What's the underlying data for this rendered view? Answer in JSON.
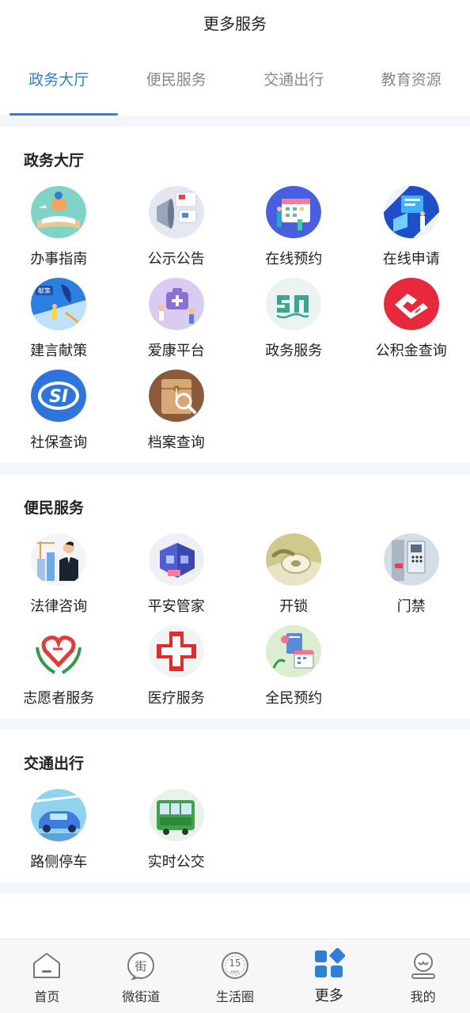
{
  "header": {
    "title": "更多服务"
  },
  "tabs": [
    {
      "label": "政务大厅"
    },
    {
      "label": "便民服务"
    },
    {
      "label": "交通出行"
    },
    {
      "label": "教育资源"
    }
  ],
  "sections": {
    "gov": {
      "title": "政务大厅",
      "items": [
        {
          "label": "办事指南",
          "icon": "guide-icon"
        },
        {
          "label": "公示公告",
          "icon": "announcement-icon"
        },
        {
          "label": "在线预约",
          "icon": "online-booking-icon"
        },
        {
          "label": "在线申请",
          "icon": "online-application-icon"
        },
        {
          "label": "建言献策",
          "icon": "suggestion-icon"
        },
        {
          "label": "爱康平台",
          "icon": "health-platform-icon"
        },
        {
          "label": "政务服务",
          "icon": "government-service-icon"
        },
        {
          "label": "公积金查询",
          "icon": "housing-fund-icon"
        },
        {
          "label": "社保查询",
          "icon": "social-security-icon"
        },
        {
          "label": "档案查询",
          "icon": "archive-icon"
        }
      ]
    },
    "life": {
      "title": "便民服务",
      "items": [
        {
          "label": "法律咨询",
          "icon": "legal-icon"
        },
        {
          "label": "平安管家",
          "icon": "safety-icon"
        },
        {
          "label": "开锁",
          "icon": "unlock-icon"
        },
        {
          "label": "门禁",
          "icon": "access-control-icon"
        },
        {
          "label": "志愿者服务",
          "icon": "volunteer-icon"
        },
        {
          "label": "医疗服务",
          "icon": "medical-icon"
        },
        {
          "label": "全民预约",
          "icon": "appointment-icon"
        }
      ]
    },
    "traffic": {
      "title": "交通出行",
      "items": [
        {
          "label": "路侧停车",
          "icon": "parking-icon"
        },
        {
          "label": "实时公交",
          "icon": "bus-icon"
        }
      ]
    }
  },
  "icon_texts": {
    "street": "街",
    "minutes_number": "15",
    "minutes_unit": "min",
    "si": "SI",
    "suggest_banner": "献策"
  },
  "tabbar": [
    {
      "label": "首页",
      "icon": "home-icon"
    },
    {
      "label": "微街道",
      "icon": "street-icon"
    },
    {
      "label": "生活圈",
      "icon": "life-circle-icon"
    },
    {
      "label": "更多",
      "icon": "more-icon"
    },
    {
      "label": "我的",
      "icon": "profile-icon"
    }
  ],
  "colors": {
    "accent": "#2f7fd6",
    "divider": "#f3f7fb"
  }
}
